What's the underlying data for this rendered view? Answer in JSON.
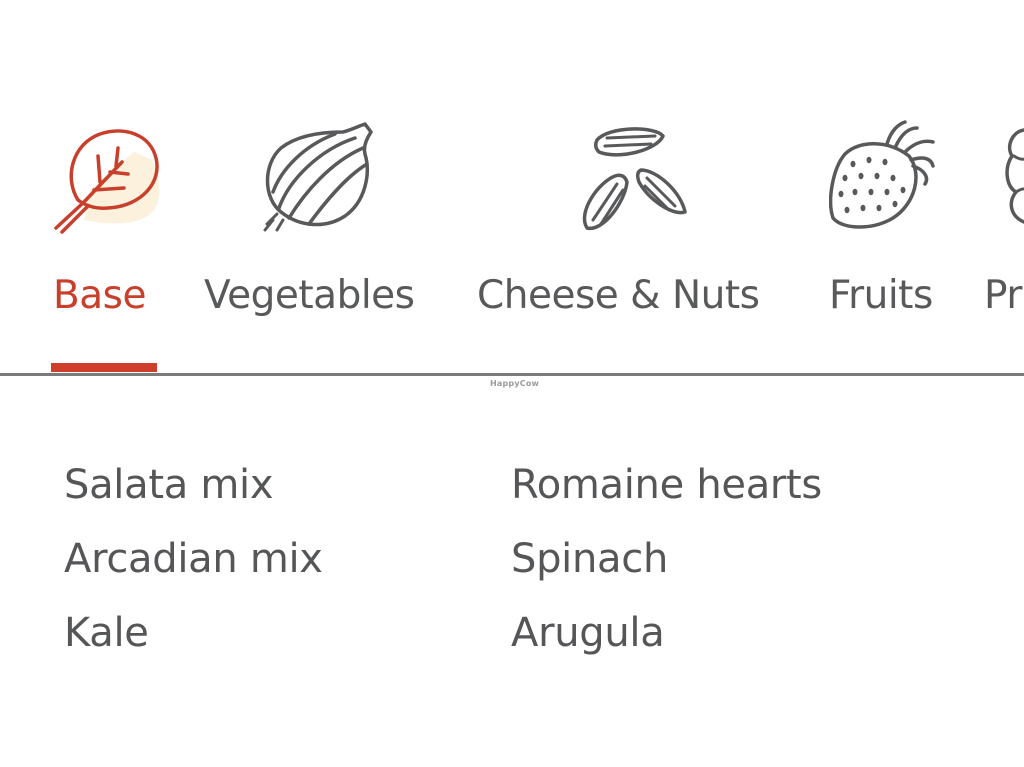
{
  "colors": {
    "accent": "#c8402c",
    "text": "#555658",
    "icon_stroke": "#58595b",
    "active_icon_fill": "#fbf1dc",
    "divider": "#7b7b7b"
  },
  "tabs": [
    {
      "label": "Base",
      "icon": "leaf-icon",
      "active": true
    },
    {
      "label": "Vegetables",
      "icon": "onion-icon",
      "active": false
    },
    {
      "label": "Cheese & Nuts",
      "icon": "almonds-icon",
      "active": false
    },
    {
      "label": "Fruits",
      "icon": "strawberry-icon",
      "active": false
    },
    {
      "label": "Pr",
      "icon": "protein-icon",
      "active": false
    }
  ],
  "watermark": "HappyCow",
  "items": {
    "column_1": [
      "Salata mix",
      "Arcadian mix",
      "Kale"
    ],
    "column_2": [
      "Romaine hearts",
      "Spinach",
      "Arugula"
    ]
  }
}
